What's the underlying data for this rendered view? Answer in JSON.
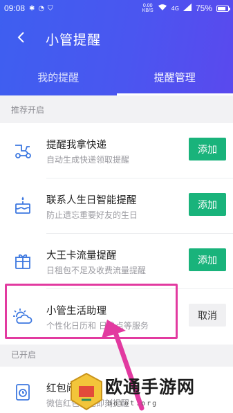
{
  "statusbar": {
    "time": "09:08",
    "speed_value": "0.00",
    "speed_unit": "KB/S",
    "network": "4G",
    "battery": "75%",
    "battery_level": 0.75
  },
  "header": {
    "title": "小管提醒"
  },
  "tabs": [
    {
      "label": "我的提醒",
      "active": false
    },
    {
      "label": "提醒管理",
      "active": true
    }
  ],
  "sections": {
    "recommended": "推荐开启",
    "enabled": "已开启"
  },
  "recommended_items": [
    {
      "name": "提醒我拿快递",
      "desc": "自动生成快递领取提醒",
      "icon": "scooter-icon",
      "action": "添加"
    },
    {
      "name": "联系人生日智能提醒",
      "desc": "防止遗忘重要好友的生日",
      "icon": "cake-icon",
      "action": "添加"
    },
    {
      "name": "大王卡流量提醒",
      "desc": "日租包不足及收费流量提醒",
      "icon": "gift-icon",
      "action": "添加"
    },
    {
      "name": "小管生活助理",
      "desc": "个性化日历和    日热点等服务",
      "icon": "weather-icon",
      "action": "取消"
    }
  ],
  "enabled_items": [
    {
      "name": "红包闹钟",
      "desc": "微信红包红包即刻提醒",
      "icon": "clock-icon"
    }
  ],
  "watermark": {
    "text": "欧通手游网",
    "sub": "boiot.org"
  },
  "colors": {
    "header_start": "#3e5ff0",
    "header_end": "#5a49ee",
    "add_button": "#19b37b",
    "highlight": "#e23aa0",
    "icon": "#3d78e0"
  }
}
